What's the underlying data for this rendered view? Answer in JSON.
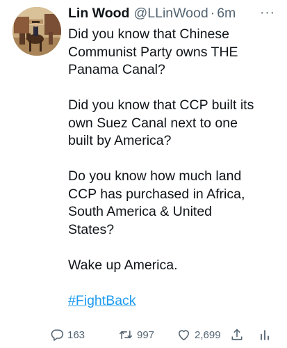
{
  "tweet": {
    "author": {
      "name": "Lin Wood",
      "handle": "@LLinWood",
      "separator": "·",
      "time": "6m",
      "avatar": "avatar-icon"
    },
    "more_icon": "more-icon",
    "more_label": "···",
    "paragraphs": [
      [
        "Did you know that Chinese",
        "Communist Party owns THE",
        "Panama Canal?"
      ],
      [
        "Did you know that CCP built its",
        "own Suez Canal next to one",
        "built by America?"
      ],
      [
        "Do you know how much land",
        "CCP has purchased in Africa,",
        "South America & United",
        "States?"
      ],
      [
        "Wake up America."
      ]
    ],
    "hashtag": "#FightBack",
    "actions": {
      "reply": {
        "icon": "reply-icon",
        "count": "163"
      },
      "retweet": {
        "icon": "retweet-icon",
        "count": "997"
      },
      "like": {
        "icon": "like-icon",
        "count": "2,699"
      },
      "share": {
        "icon": "share-icon"
      },
      "analytics": {
        "icon": "analytics-icon"
      }
    },
    "colors": {
      "text": "#0f1419",
      "secondary": "#536471",
      "link": "#1d9bf0"
    }
  }
}
